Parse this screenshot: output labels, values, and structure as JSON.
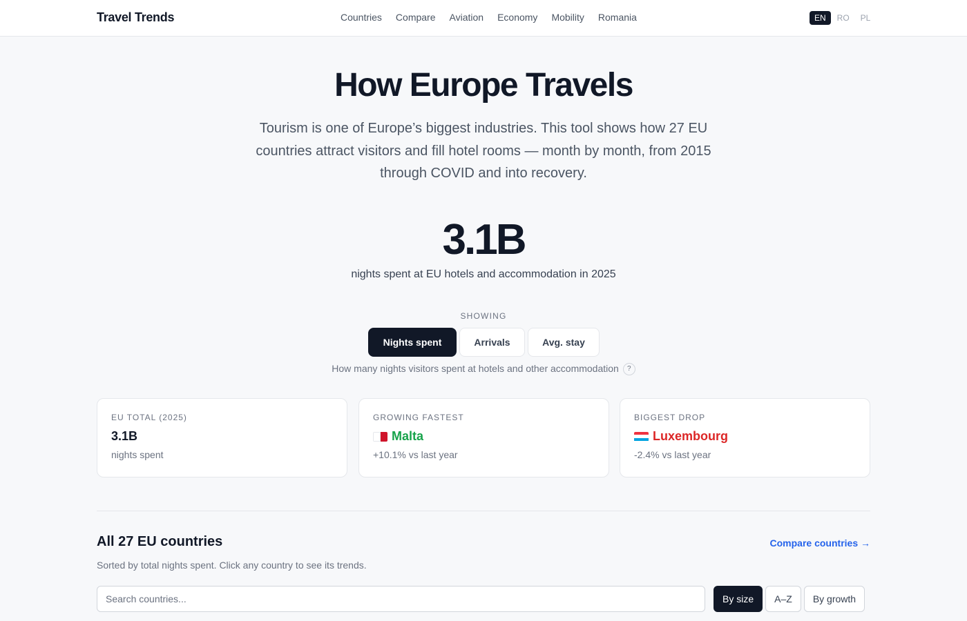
{
  "header": {
    "brand": "Travel Trends",
    "nav": [
      "Countries",
      "Compare",
      "Aviation",
      "Economy",
      "Mobility",
      "Romania"
    ],
    "languages": [
      "EN",
      "RO",
      "PL"
    ],
    "active_language": "EN"
  },
  "hero": {
    "title": "How Europe Travels",
    "description": "Tourism is one of Europe’s biggest industries. This tool shows how 27 EU countries attract visitors and fill hotel rooms — month by month, from 2015 through COVID and into recovery.",
    "big_number": "3.1B",
    "big_caption": "nights spent at EU hotels and accommodation in 2025"
  },
  "metric": {
    "label": "SHOWING",
    "options": [
      "Nights spent",
      "Arrivals",
      "Avg. stay"
    ],
    "selected": "Nights spent",
    "help": "How many nights visitors spent at hotels and other accommodation",
    "help_icon": "?"
  },
  "cards": [
    {
      "label": "EU TOTAL (2025)",
      "value": "3.1B",
      "sub": "nights spent"
    },
    {
      "label": "GROWING FASTEST",
      "value": "Malta",
      "sub": "+10.1% vs last year",
      "color": "#16a34a",
      "flag": "malta-flag-icon"
    },
    {
      "label": "BIGGEST DROP",
      "value": "Luxembourg",
      "sub": "-2.4% vs last year",
      "color": "#dc2626",
      "flag": "luxembourg-flag-icon"
    }
  ],
  "list": {
    "title": "All 27 EU countries",
    "compare_link": "Compare countries →",
    "subtitle": "Sorted by total nights spent. Click any country to see its trends.",
    "search_placeholder": "Search countries...",
    "sort_options": [
      "By size",
      "A–Z",
      "By growth"
    ],
    "sort_selected": "By size"
  },
  "colors": {
    "accent": "#111827",
    "link": "#2563eb",
    "positive": "#16a34a",
    "negative": "#dc2626"
  }
}
